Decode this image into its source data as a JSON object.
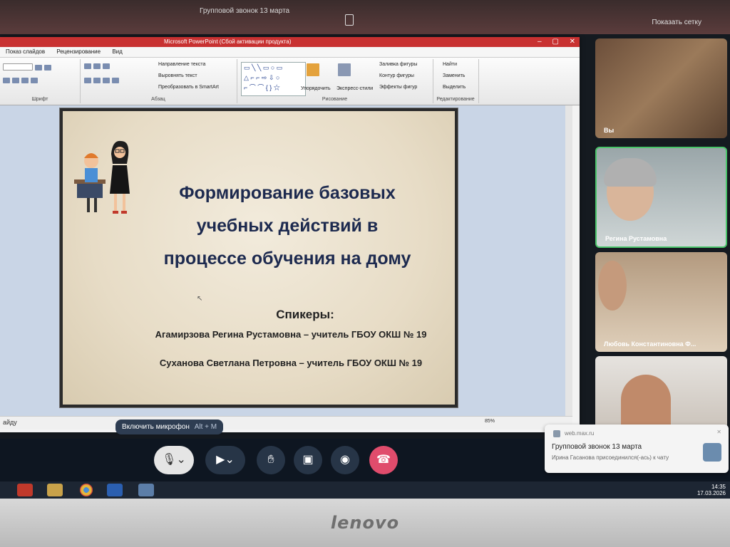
{
  "top": {
    "call_title": "Групповой звонок 13 марта",
    "show_grid": "Показать сетку"
  },
  "ppt": {
    "window_title": "Microsoft PowerPoint (Сбой активации продукта)",
    "menu": [
      "Показ слайдов",
      "Рецензирование",
      "Вид"
    ],
    "ribbon": {
      "font_label": "Шрифт",
      "paragraph_label": "Абзац",
      "drawing_label": "Рисование",
      "editing_label": "Редактирование",
      "text_direction": "Направление текста",
      "align_text": "Выровнять текст",
      "smartart": "Преобразовать в SmartArt",
      "arrange": "Упорядочить",
      "quick_styles": "Экспресс-стили",
      "shape_fill": "Заливка фигуры",
      "shape_outline": "Контур фигуры",
      "shape_effects": "Эффекты фигур",
      "find": "Найти",
      "replace": "Заменить",
      "select": "Выделить"
    },
    "status_left": "айду",
    "zoom": "85%"
  },
  "slide": {
    "title_lines": [
      "Формирование базовых",
      "учебных действий в",
      "процессе обучения на дому"
    ],
    "speakers_label": "Спикеры:",
    "speaker1": "Агамирзова  Регина  Рустамовна – учитель ГБОУ ОКШ № 19",
    "speaker2": "Суханова Светлана Петровна – учитель ГБОУ ОКШ № 19"
  },
  "participants": [
    {
      "name": "Вы"
    },
    {
      "name": "Регина Рустамовна"
    },
    {
      "name": "Любовь Константиновна Ф..."
    }
  ],
  "controls": {
    "mic_tooltip": "Включить микрофон",
    "mic_hotkey": "Alt + M"
  },
  "notification": {
    "app": "web.max.ru",
    "title": "Групповой звонок 13 марта",
    "text": "Ирина Гасанова присоединился(-ась) к чату"
  },
  "taskbar": {
    "time": "14:35",
    "date": "17.03.2026"
  },
  "bezel": {
    "logo": "lenovo"
  },
  "colors": {
    "accent_red": "#c83131",
    "end_call": "#e04c6c",
    "speaking_border": "#4ac46a",
    "slide_title": "#1d2a4f"
  }
}
